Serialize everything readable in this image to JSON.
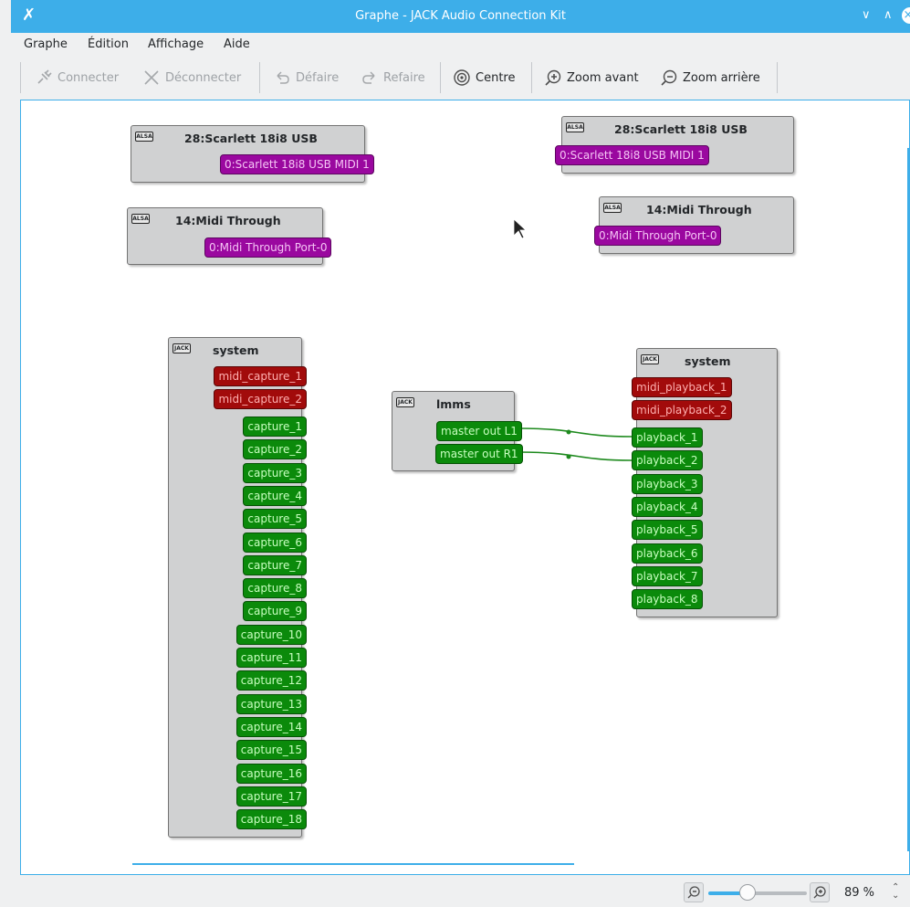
{
  "window": {
    "title": "Graphe - JACK Audio Connection Kit",
    "app_icon": "✗",
    "minimize": "∨",
    "maximize": "∧",
    "close": "×"
  },
  "menu": [
    "Graphe",
    "Édition",
    "Affichage",
    "Aide"
  ],
  "toolbar": {
    "connect": "Connecter",
    "disconnect": "Déconnecter",
    "undo": "Défaire",
    "redo": "Refaire",
    "center": "Centre",
    "zoom_in": "Zoom avant",
    "zoom_out": "Zoom arrière"
  },
  "nodes": {
    "scarlett_left": {
      "title": "28:Scarlett 18i8 USB",
      "icon": "ALSA",
      "port": "0:Scarlett 18i8 USB MIDI 1"
    },
    "midi_left": {
      "title": "14:Midi Through",
      "icon": "ALSA",
      "port": "0:Midi Through Port-0"
    },
    "scarlett_right": {
      "title": "28:Scarlett 18i8 USB",
      "icon": "ALSA",
      "port": "0:Scarlett 18i8 USB MIDI 1"
    },
    "midi_right": {
      "title": "14:Midi Through",
      "icon": "ALSA",
      "port": "0:Midi Through Port-0"
    },
    "system_capture": {
      "title": "system",
      "icon": "JACK",
      "midi_ports": [
        "midi_capture_1",
        "midi_capture_2"
      ],
      "audio_ports": [
        "capture_1",
        "capture_2",
        "capture_3",
        "capture_4",
        "capture_5",
        "capture_6",
        "capture_7",
        "capture_8",
        "capture_9",
        "capture_10",
        "capture_11",
        "capture_12",
        "capture_13",
        "capture_14",
        "capture_15",
        "capture_16",
        "capture_17",
        "capture_18"
      ]
    },
    "lmms": {
      "title": "lmms",
      "icon": "JACK",
      "audio_ports": [
        "master out L1",
        "master out R1"
      ]
    },
    "system_playback": {
      "title": "system",
      "icon": "JACK",
      "midi_ports": [
        "midi_playback_1",
        "midi_playback_2"
      ],
      "audio_ports": [
        "playback_1",
        "playback_2",
        "playback_3",
        "playback_4",
        "playback_5",
        "playback_6",
        "playback_7",
        "playback_8"
      ]
    }
  },
  "connections": [
    {
      "from": "master out L1",
      "to": "playback_1"
    },
    {
      "from": "master out R1",
      "to": "playback_2"
    }
  ],
  "status": {
    "zoom_value": "89 %",
    "zoom_fraction": 0.4
  },
  "colors": {
    "accent": "#3daee9",
    "midi_alsa": "#9a089f",
    "midi_jack": "#a20b0b",
    "audio": "#0b8a0b",
    "wire": "#1e8a1e"
  }
}
